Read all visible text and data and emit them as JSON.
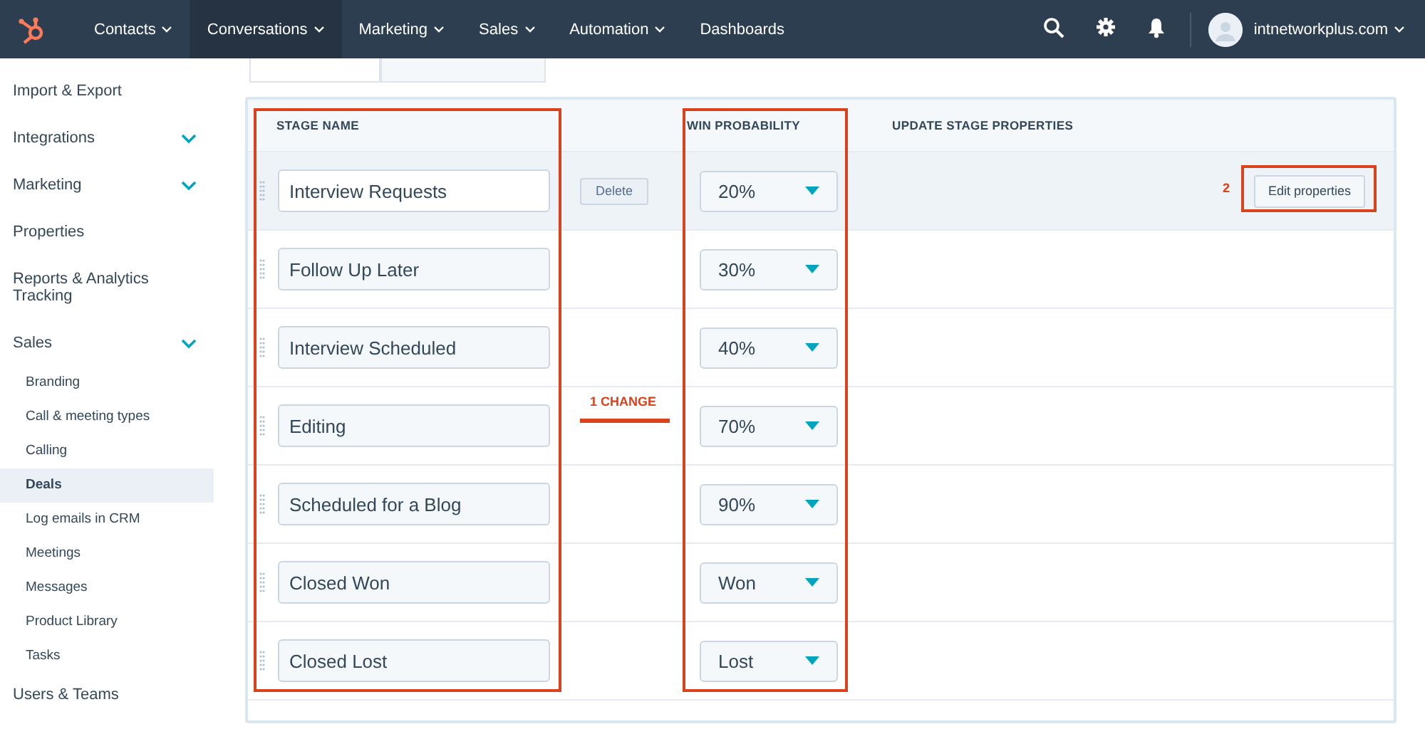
{
  "nav": {
    "items": [
      {
        "label": "Contacts",
        "kind": "menu",
        "selected": false
      },
      {
        "label": "Conversations",
        "kind": "menu",
        "selected": true
      },
      {
        "label": "Marketing",
        "kind": "menu",
        "selected": false
      },
      {
        "label": "Sales",
        "kind": "menu",
        "selected": false
      },
      {
        "label": "Automation",
        "kind": "menu",
        "selected": false
      },
      {
        "label": "Dashboards",
        "kind": "link",
        "selected": false
      }
    ],
    "account": "intnetworkplus.com"
  },
  "sidebar": {
    "items": [
      {
        "label": "Import & Export",
        "kind": "link"
      },
      {
        "label": "Integrations",
        "kind": "group"
      },
      {
        "label": "Marketing",
        "kind": "group"
      },
      {
        "label": "Properties",
        "kind": "link"
      },
      {
        "label": "Reports & Analytics Tracking",
        "kind": "link"
      },
      {
        "label": "Sales",
        "kind": "group",
        "children": [
          {
            "label": "Branding",
            "selected": false
          },
          {
            "label": "Call & meeting types",
            "selected": false
          },
          {
            "label": "Calling",
            "selected": false
          },
          {
            "label": "Deals",
            "selected": true
          },
          {
            "label": "Log emails in CRM",
            "selected": false
          },
          {
            "label": "Meetings",
            "selected": false
          },
          {
            "label": "Messages",
            "selected": false
          },
          {
            "label": "Product Library",
            "selected": false
          },
          {
            "label": "Tasks",
            "selected": false
          }
        ]
      },
      {
        "label": "Users & Teams",
        "kind": "link"
      }
    ]
  },
  "tabs": [
    {
      "selected": true
    },
    {
      "selected": false
    }
  ],
  "table": {
    "columns": [
      "STAGE NAME",
      "WIN PROBABILITY",
      "UPDATE STAGE PROPERTIES"
    ],
    "rows": [
      {
        "name": "Interview Requests",
        "probability": "20%",
        "hovered": true,
        "delete": "Delete",
        "action": "Edit properties"
      },
      {
        "name": "Follow Up Later",
        "probability": "30%",
        "hovered": false
      },
      {
        "name": "Interview Scheduled",
        "probability": "40%",
        "hovered": false
      },
      {
        "name": "Editing",
        "probability": "70%",
        "hovered": false
      },
      {
        "name": "Scheduled for a Blog",
        "probability": "90%",
        "hovered": false
      },
      {
        "name": "Closed Won",
        "probability": "Won",
        "hovered": false
      },
      {
        "name": "Closed Lost",
        "probability": "Lost",
        "hovered": false
      }
    ]
  },
  "annotations": {
    "change_label": "1 CHANGE",
    "step_number": "2"
  }
}
